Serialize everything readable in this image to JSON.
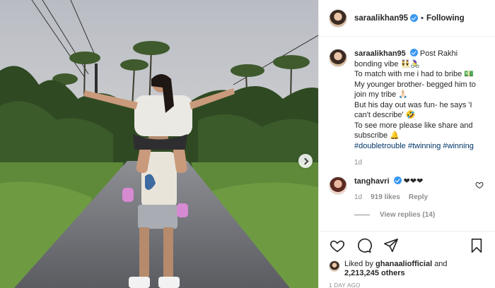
{
  "post": {
    "username": "saraalikhan95",
    "follow_label": "Following",
    "separator": "•"
  },
  "caption": {
    "username": "saraalikhan95",
    "lines": [
      "Post Rakhi bonding vibe 👯‍♂️🚴‍♀️",
      "To match with me i had to bribe 💵",
      "My younger brother- begged him to join my tribe 🙏🏻",
      "But his day out was fun- he says 'I can't describe' 🤣",
      "To see more please like share and subscribe 🔔"
    ],
    "hashtags": [
      "#doubletrouble",
      "#twinning",
      "#winning"
    ],
    "time": "1d"
  },
  "comments": [
    {
      "username": "tanghavri",
      "text": "❤❤❤",
      "time": "1d",
      "likes": "919 likes",
      "reply_label": "Reply"
    }
  ],
  "view_replies": "View replies (14)",
  "likes": {
    "prefix": "Liked by",
    "user": "ghanaaliofficial",
    "and": "and",
    "count": "2,213,245 others"
  },
  "time_ago": "1 DAY AGO",
  "icons": {
    "like": "heart-icon",
    "comment": "comment-icon",
    "share": "share-icon",
    "save": "bookmark-icon",
    "next": "chevron-right-icon"
  },
  "colors": {
    "verified": "#3897f0",
    "hashtag": "#003569",
    "muted": "#8e8e8e"
  }
}
